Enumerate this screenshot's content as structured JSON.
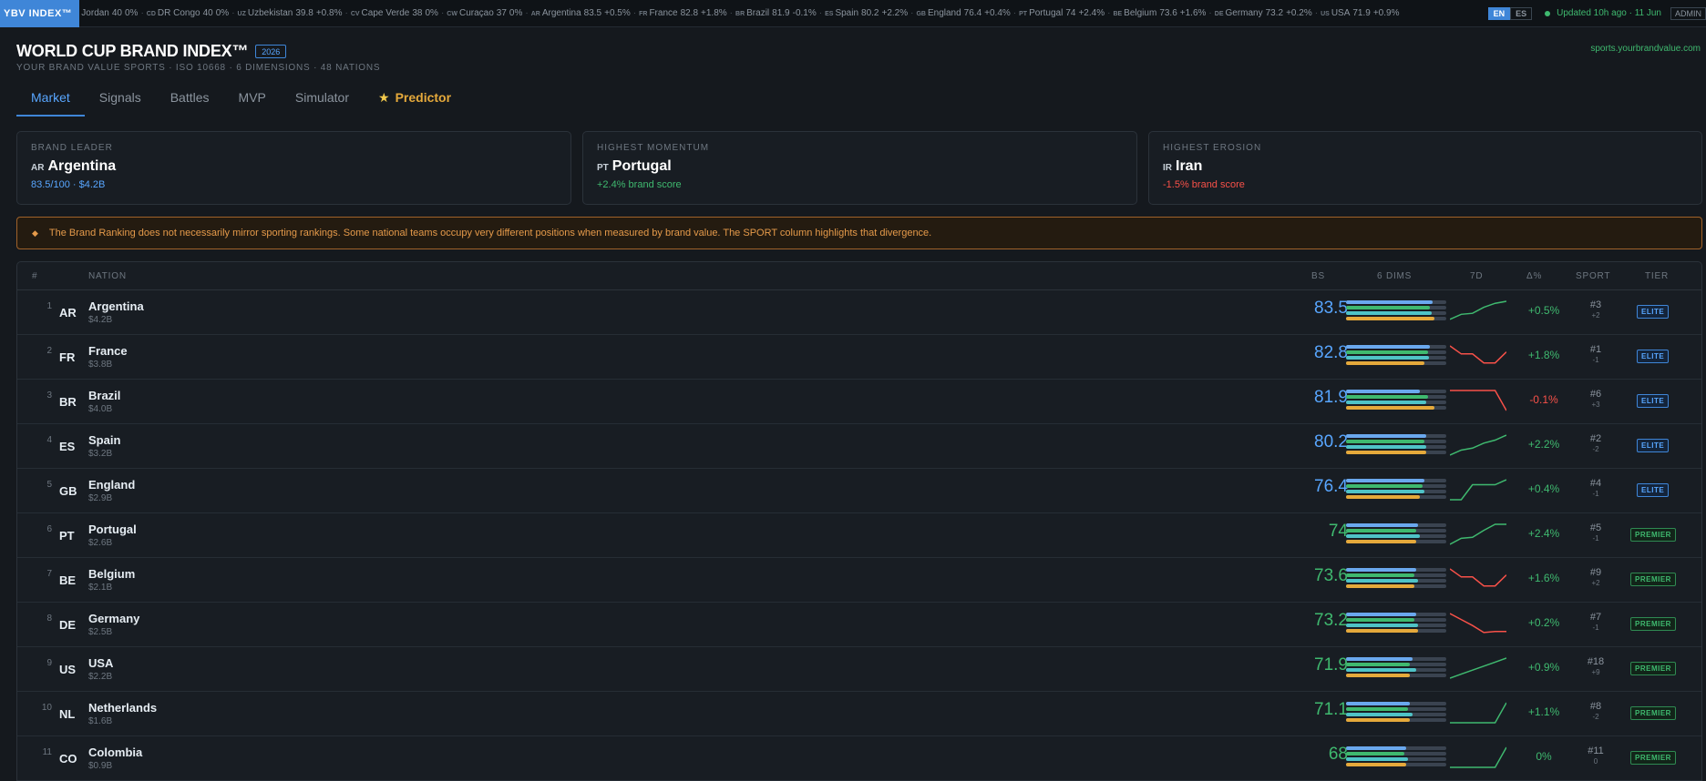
{
  "brand": "YBV INDEX™",
  "ticker": [
    {
      "code": "",
      "name": "Jordan",
      "score": "40",
      "delta": "0%"
    },
    {
      "code": "CD",
      "name": "DR Congo",
      "score": "40",
      "delta": "0%"
    },
    {
      "code": "UZ",
      "name": "Uzbekistan",
      "score": "39.8",
      "delta": "+0.8%"
    },
    {
      "code": "CV",
      "name": "Cape Verde",
      "score": "38",
      "delta": "0%"
    },
    {
      "code": "CW",
      "name": "Curaçao",
      "score": "37",
      "delta": "0%"
    },
    {
      "code": "AR",
      "name": "Argentina",
      "score": "83.5",
      "delta": "+0.5%"
    },
    {
      "code": "FR",
      "name": "France",
      "score": "82.8",
      "delta": "+1.8%"
    },
    {
      "code": "BR",
      "name": "Brazil",
      "score": "81.9",
      "delta": "-0.1%"
    },
    {
      "code": "ES",
      "name": "Spain",
      "score": "80.2",
      "delta": "+2.2%"
    },
    {
      "code": "GB",
      "name": "England",
      "score": "76.4",
      "delta": "+0.4%"
    },
    {
      "code": "PT",
      "name": "Portugal",
      "score": "74",
      "delta": "+2.4%"
    },
    {
      "code": "BE",
      "name": "Belgium",
      "score": "73.6",
      "delta": "+1.6%"
    },
    {
      "code": "DE",
      "name": "Germany",
      "score": "73.2",
      "delta": "+0.2%"
    },
    {
      "code": "US",
      "name": "USA",
      "score": "71.9",
      "delta": "+0.9%"
    }
  ],
  "lang": {
    "en": "EN",
    "es": "ES"
  },
  "updated": "Updated 10h ago · 11 Jun",
  "admin": "ADMIN",
  "header": {
    "title": "WORLD CUP BRAND INDEX™",
    "year": "2026",
    "subtitle": "YOUR BRAND VALUE SPORTS · ISO 10668 · 6 DIMENSIONS · 48 NATIONS",
    "site": "sports.yourbrandvalue.com"
  },
  "tabs": [
    "Market",
    "Signals",
    "Battles",
    "MVP",
    "Simulator",
    "Predictor"
  ],
  "cards": [
    {
      "label": "BRAND LEADER",
      "code": "AR",
      "name": "Argentina",
      "sub": "83.5/100 · $4.2B",
      "color": "#58a6ff"
    },
    {
      "label": "HIGHEST MOMENTUM",
      "code": "PT",
      "name": "Portugal",
      "sub": "+2.4% brand score",
      "color": "#3fb96f"
    },
    {
      "label": "HIGHEST EROSION",
      "code": "IR",
      "name": "Iran",
      "sub": "-1.5% brand score",
      "color": "#f85149"
    }
  ],
  "notice": "The Brand Ranking does not necessarily mirror sporting rankings. Some national teams occupy very different positions when measured by brand value. The SPORT column highlights that divergence.",
  "columns": {
    "rank": "#",
    "nation": "NATION",
    "bs": "BS",
    "dims": "6 DIMS",
    "trend": "7D",
    "delta": "Δ%",
    "sport": "SPORT",
    "tier": "TIER"
  },
  "colors": {
    "elite_bs": "#58a6ff",
    "premier_bs": "#3fb96f",
    "up": "#3fb96f",
    "down": "#f85149",
    "dim_blue": "#6aa8ee",
    "dim_green": "#3fb96f",
    "dim_teal": "#4fc3c7",
    "dim_orange": "#e5a93b"
  },
  "rows": [
    {
      "rank": "1",
      "code": "AR",
      "name": "Argentina",
      "value": "$4.2B",
      "bs": "83.5",
      "dims": [
        0.86,
        0.84,
        0.85,
        0.88
      ],
      "trend": "up",
      "spark": [
        0.1,
        0.35,
        0.4,
        0.7,
        0.9,
        1.0
      ],
      "delta": "+0.5%",
      "sport": "#3",
      "sport_delta": "+2",
      "tier": "ELITE"
    },
    {
      "rank": "2",
      "code": "FR",
      "name": "France",
      "value": "$3.8B",
      "bs": "82.8",
      "dims": [
        0.84,
        0.82,
        0.83,
        0.78
      ],
      "trend": "down",
      "spark": [
        1.0,
        0.6,
        0.6,
        0.15,
        0.15,
        0.7
      ],
      "delta": "+1.8%",
      "sport": "#1",
      "sport_delta": "-1",
      "tier": "ELITE"
    },
    {
      "rank": "3",
      "code": "BR",
      "name": "Brazil",
      "value": "$4.0B",
      "bs": "81.9",
      "dims": [
        0.74,
        0.82,
        0.8,
        0.88
      ],
      "trend": "down",
      "spark": [
        1.0,
        1.0,
        1.0,
        1.0,
        1.0,
        0.0
      ],
      "delta": "-0.1%",
      "sport": "#6",
      "sport_delta": "+3",
      "tier": "ELITE"
    },
    {
      "rank": "4",
      "code": "ES",
      "name": "Spain",
      "value": "$3.2B",
      "bs": "80.2",
      "dims": [
        0.8,
        0.78,
        0.8,
        0.8
      ],
      "trend": "up",
      "spark": [
        0.0,
        0.25,
        0.35,
        0.6,
        0.75,
        1.0
      ],
      "delta": "+2.2%",
      "sport": "#2",
      "sport_delta": "-2",
      "tier": "ELITE"
    },
    {
      "rank": "5",
      "code": "GB",
      "name": "England",
      "value": "$2.9B",
      "bs": "76.4",
      "dims": [
        0.78,
        0.76,
        0.78,
        0.74
      ],
      "trend": "up",
      "spark": [
        0.0,
        0.0,
        0.75,
        0.75,
        0.75,
        1.0
      ],
      "delta": "+0.4%",
      "sport": "#4",
      "sport_delta": "-1",
      "tier": "ELITE"
    },
    {
      "rank": "6",
      "code": "PT",
      "name": "Portugal",
      "value": "$2.6B",
      "bs": "74",
      "dims": [
        0.72,
        0.7,
        0.74,
        0.7
      ],
      "trend": "up",
      "spark": [
        0.0,
        0.3,
        0.35,
        0.7,
        1.0,
        1.0
      ],
      "delta": "+2.4%",
      "sport": "#5",
      "sport_delta": "-1",
      "tier": "PREMIER"
    },
    {
      "rank": "7",
      "code": "BE",
      "name": "Belgium",
      "value": "$2.1B",
      "bs": "73.6",
      "dims": [
        0.7,
        0.68,
        0.72,
        0.68
      ],
      "trend": "down",
      "spark": [
        1.0,
        0.6,
        0.6,
        0.15,
        0.15,
        0.7
      ],
      "delta": "+1.6%",
      "sport": "#9",
      "sport_delta": "+2",
      "tier": "PREMIER"
    },
    {
      "rank": "8",
      "code": "DE",
      "name": "Germany",
      "value": "$2.5B",
      "bs": "73.2",
      "dims": [
        0.7,
        0.68,
        0.72,
        0.72
      ],
      "trend": "down",
      "spark": [
        1.0,
        0.7,
        0.4,
        0.05,
        0.1,
        0.1
      ],
      "delta": "+0.2%",
      "sport": "#7",
      "sport_delta": "-1",
      "tier": "PREMIER"
    },
    {
      "rank": "9",
      "code": "US",
      "name": "USA",
      "value": "$2.2B",
      "bs": "71.9",
      "dims": [
        0.66,
        0.64,
        0.7,
        0.64
      ],
      "trend": "up",
      "spark": [
        0.0,
        0.2,
        0.4,
        0.6,
        0.8,
        1.0
      ],
      "delta": "+0.9%",
      "sport": "#18",
      "sport_delta": "+9",
      "tier": "PREMIER"
    },
    {
      "rank": "10",
      "code": "NL",
      "name": "Netherlands",
      "value": "$1.6B",
      "bs": "71.1",
      "dims": [
        0.64,
        0.62,
        0.66,
        0.64
      ],
      "trend": "up",
      "spark": [
        0.0,
        0.0,
        0.0,
        0.0,
        0.0,
        1.0
      ],
      "delta": "+1.1%",
      "sport": "#8",
      "sport_delta": "-2",
      "tier": "PREMIER"
    },
    {
      "rank": "11",
      "code": "CO",
      "name": "Colombia",
      "value": "$0.9B",
      "bs": "68",
      "dims": [
        0.6,
        0.58,
        0.62,
        0.6
      ],
      "trend": "up",
      "spark": [
        0.0,
        0.0,
        0.0,
        0.0,
        0.0,
        1.0
      ],
      "delta": "0%",
      "sport": "#11",
      "sport_delta": "0",
      "tier": "PREMIER"
    }
  ]
}
